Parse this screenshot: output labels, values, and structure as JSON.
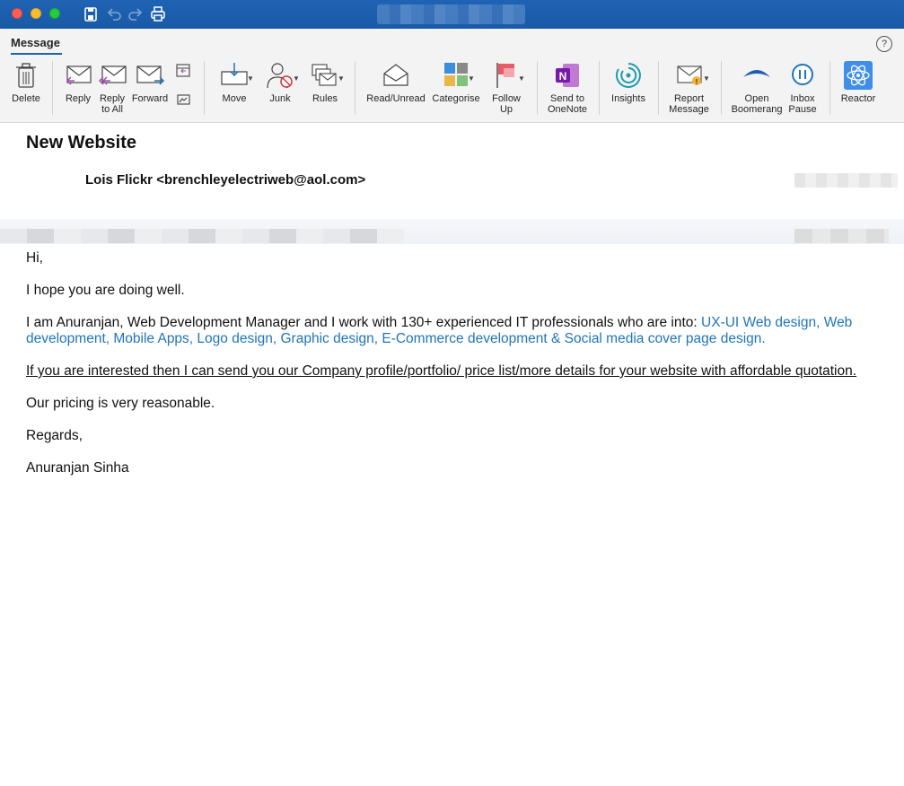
{
  "window": {
    "title_blurred": true
  },
  "ribbon": {
    "tab": "Message",
    "help": "?",
    "buttons": {
      "delete": "Delete",
      "reply": "Reply",
      "reply_all_1": "Reply",
      "reply_all_2": "to All",
      "forward": "Forward",
      "move": "Move",
      "junk": "Junk",
      "rules": "Rules",
      "read_unread": "Read/Unread",
      "categorise": "Categorise",
      "follow_up_1": "Follow",
      "follow_up_2": "Up",
      "onenote_1": "Send to",
      "onenote_2": "OneNote",
      "insights": "Insights",
      "report_1": "Report",
      "report_2": "Message",
      "boomerang_1": "Open",
      "boomerang_2": "Boomerang",
      "inbox_pause_1": "Inbox",
      "inbox_pause_2": "Pause",
      "reactor": "Reactor"
    }
  },
  "message": {
    "subject": "New Website",
    "sender": "Lois Flickr <brenchleyelectriweb@aol.com>",
    "body": {
      "greeting": "Hi,",
      "line1": "I hope you are doing well.",
      "line2_prefix": "I am Anuranjan, Web Development Manager and I work with 130+ experienced IT professionals who are into: ",
      "line2_link": "UX-UI Web design, Web development, Mobile Apps, Logo design, Graphic design, E-Commerce development & Social media cover page design.",
      "line3": "If you are interested then I can send you our Company profile/portfolio/ price list/more details for your website with affordable quotation.",
      "line4": "Our pricing is very reasonable.",
      "closing": "Regards,",
      "signature": "Anuranjan Sinha"
    }
  },
  "colors": {
    "titlebar": "#1f63b4",
    "link": "#1f75b9",
    "ribbon_bg": "#f3f3f3"
  }
}
